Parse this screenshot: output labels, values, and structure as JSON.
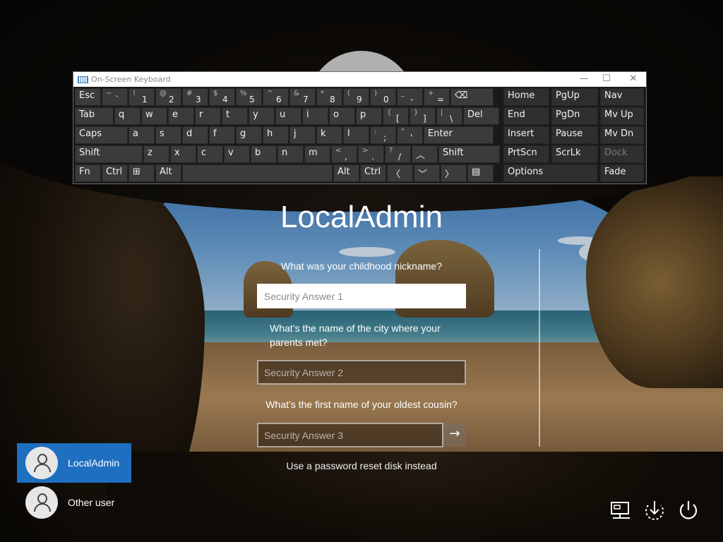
{
  "osk": {
    "title": "On-Screen Keyboard",
    "window_buttons": [
      "—",
      "☐",
      "✕"
    ],
    "rows": [
      [
        {
          "label": "Esc"
        },
        {
          "shift": "~",
          "main": "`"
        },
        {
          "shift": "!",
          "main": "1"
        },
        {
          "shift": "@",
          "main": "2"
        },
        {
          "shift": "#",
          "main": "3"
        },
        {
          "shift": "$",
          "main": "4"
        },
        {
          "shift": "%",
          "main": "5"
        },
        {
          "shift": "^",
          "main": "6"
        },
        {
          "shift": "&",
          "main": "7"
        },
        {
          "shift": "*",
          "main": "8"
        },
        {
          "shift": "(",
          "main": "9"
        },
        {
          "shift": ")",
          "main": "0"
        },
        {
          "shift": "_",
          "main": "-"
        },
        {
          "shift": "+",
          "main": "="
        },
        {
          "label": "⌫"
        }
      ],
      [
        {
          "label": "Tab"
        },
        {
          "label": "q"
        },
        {
          "label": "w"
        },
        {
          "label": "e"
        },
        {
          "label": "r"
        },
        {
          "label": "t"
        },
        {
          "label": "y"
        },
        {
          "label": "u"
        },
        {
          "label": "i"
        },
        {
          "label": "o"
        },
        {
          "label": "p"
        },
        {
          "shift": "{",
          "main": "["
        },
        {
          "shift": "}",
          "main": "]"
        },
        {
          "shift": "|",
          "main": "\\"
        },
        {
          "label": "Del"
        }
      ],
      [
        {
          "label": "Caps"
        },
        {
          "label": "a"
        },
        {
          "label": "s"
        },
        {
          "label": "d"
        },
        {
          "label": "f"
        },
        {
          "label": "g"
        },
        {
          "label": "h"
        },
        {
          "label": "j"
        },
        {
          "label": "k"
        },
        {
          "label": "l"
        },
        {
          "shift": ":",
          "main": ";"
        },
        {
          "shift": "\"",
          "main": "'"
        },
        {
          "label": "Enter"
        }
      ],
      [
        {
          "label": "Shift"
        },
        {
          "label": "z"
        },
        {
          "label": "x"
        },
        {
          "label": "c"
        },
        {
          "label": "v"
        },
        {
          "label": "b"
        },
        {
          "label": "n"
        },
        {
          "label": "m"
        },
        {
          "shift": "<",
          "main": ","
        },
        {
          "shift": ">",
          "main": "."
        },
        {
          "shift": "?",
          "main": "/"
        },
        {
          "label": "︿"
        },
        {
          "label": "Shift"
        }
      ],
      [
        {
          "label": "Fn"
        },
        {
          "label": "Ctrl"
        },
        {
          "label": "⊞"
        },
        {
          "label": "Alt"
        },
        {
          "label": ""
        },
        {
          "label": "Alt"
        },
        {
          "label": "Ctrl"
        },
        {
          "label": "〈"
        },
        {
          "label": "﹀"
        },
        {
          "label": "〉"
        },
        {
          "label": "▤"
        }
      ]
    ],
    "side_keys": [
      [
        "Home",
        "PgUp",
        "Nav"
      ],
      [
        "End",
        "PgDn",
        "Mv Up"
      ],
      [
        "Insert",
        "Pause",
        "Mv Dn"
      ],
      [
        "PrtScn",
        "ScrLk",
        "Dock"
      ],
      [
        "Options",
        "Fade"
      ]
    ]
  },
  "login": {
    "username": "LocalAdmin",
    "question1": "What was your childhood nickname?",
    "answer1_placeholder": "Security Answer 1",
    "question2": "What’s the name of the city where your parents met?",
    "answer2_placeholder": "Security Answer 2",
    "question3": "What’s the first name of your oldest cousin?",
    "answer3_placeholder": "Security Answer 3",
    "submit_icon": "arrow-right",
    "submit_glyph": "→",
    "reset_link": "Use a password reset disk instead"
  },
  "users": [
    {
      "name": "LocalAdmin",
      "selected": true
    },
    {
      "name": "Other user",
      "selected": false
    }
  ],
  "system_icons": [
    "network-icon",
    "ease-of-access-icon",
    "power-icon"
  ],
  "colors": {
    "selected_user": "#1e6fc0",
    "keyboard_key": "#3b3b3b",
    "keyboard_bg": "#1a1a1a"
  }
}
